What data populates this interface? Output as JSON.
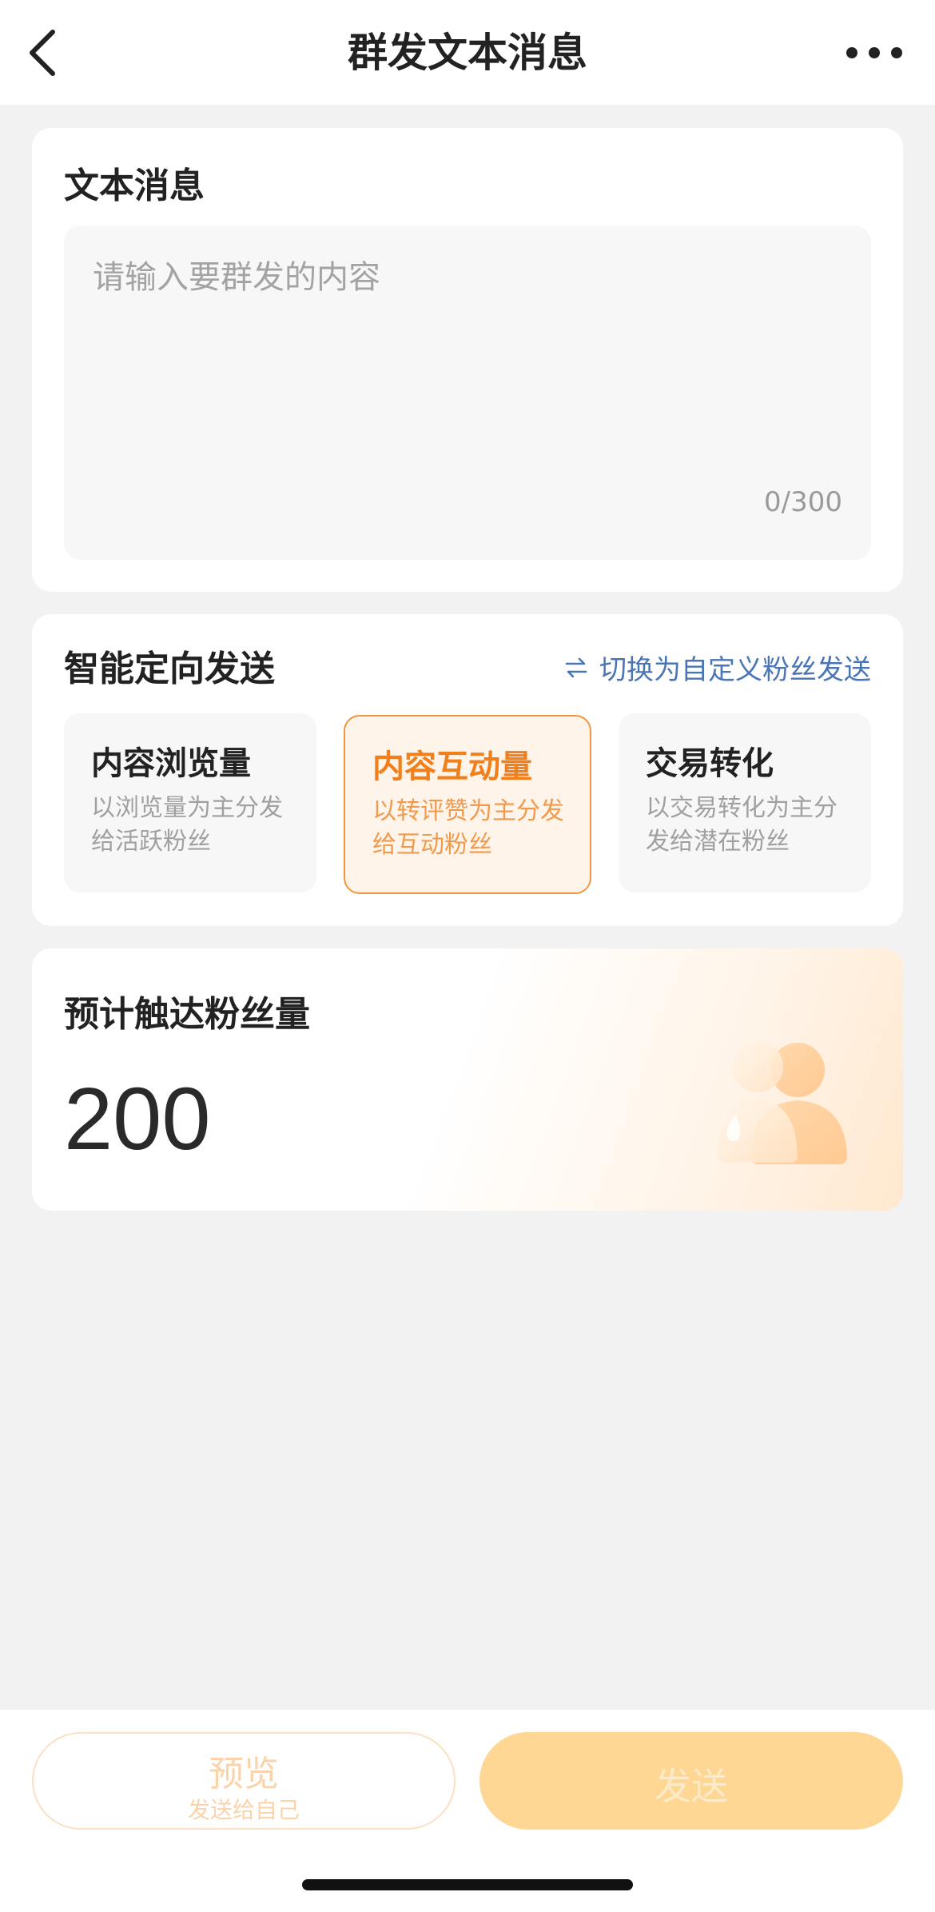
{
  "navbar": {
    "title": "群发文本消息",
    "back_icon": "chevron-left-icon",
    "more_icon": "more-dots-icon"
  },
  "text_message": {
    "title": "文本消息",
    "placeholder": "请输入要群发的内容",
    "counter": "0/300"
  },
  "smart_targeting": {
    "title": "智能定向发送",
    "switch_label": "切换为自定义粉丝发送",
    "switch_icon": "swap-arrows-icon",
    "options": [
      {
        "title": "内容浏览量",
        "desc": "以浏览量为主分发给活跃粉丝",
        "selected": false
      },
      {
        "title": "内容互动量",
        "desc": "以转评赞为主分发给互动粉丝",
        "selected": true
      },
      {
        "title": "交易转化",
        "desc": "以交易转化为主分发给潜在粉丝",
        "selected": false
      }
    ]
  },
  "reach": {
    "title": "预计触达粉丝量",
    "value": "200",
    "illustration_icon": "fans-group-icon"
  },
  "bottom": {
    "preview_label": "预览",
    "preview_sub": "发送给自己",
    "send_label": "发送"
  },
  "colors": {
    "accent": "#f07f1c",
    "link": "#4a76b5",
    "send_disabled": "#fed795",
    "page_bg": "#f2f2f2"
  }
}
